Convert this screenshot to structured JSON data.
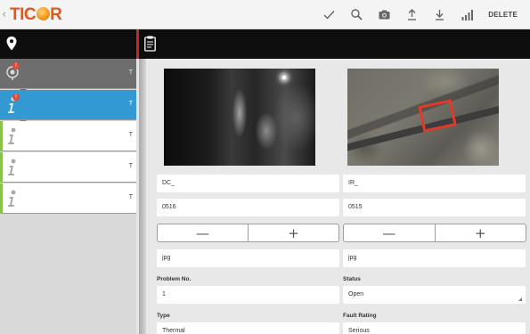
{
  "app": {
    "brand": {
      "pre": "TIC",
      "post": "R"
    },
    "back_glyph": "‹"
  },
  "toolbar": {
    "icons": [
      "check-icon",
      "search-icon",
      "camera-icon",
      "upload-icon",
      "download-icon",
      "signal-icon"
    ],
    "delete_label": "DELETE"
  },
  "left_header": {
    "icon": "location-pin-icon"
  },
  "right_header": {
    "icon": "clipboard-icon"
  },
  "list": {
    "items": [
      {
        "icon": "warning-marker-icon",
        "badge": "!",
        "type": "T",
        "style": "gray"
      },
      {
        "icon": "info-icon",
        "badge": "!",
        "type": "T",
        "style": "blue"
      },
      {
        "icon": "info-icon",
        "type": "T",
        "style": "white"
      },
      {
        "icon": "info-icon",
        "type": "T",
        "style": "white"
      },
      {
        "icon": "info-icon",
        "type": "T",
        "style": "white"
      }
    ]
  },
  "form": {
    "left": {
      "image_name": "DC_",
      "image_number": "0516",
      "extension": "jpg"
    },
    "right": {
      "image_name": "IR_",
      "image_number": "0515",
      "extension": "jpg"
    },
    "stepper": {
      "minus": "—",
      "plus": "+"
    },
    "problem_no": {
      "label": "Problem No.",
      "value": "1"
    },
    "status": {
      "label": "Status",
      "value": "Open"
    },
    "type": {
      "label": "Type",
      "value": "Thermal"
    },
    "fault_rating": {
      "label": "Fault Rating",
      "value": "Serious"
    }
  },
  "colors": {
    "brand": "#e2561c",
    "accent_blue": "#3399d2",
    "divider_red": "#c6262e",
    "badge_red": "#e24a3b",
    "list_green": "#8bc34a"
  }
}
